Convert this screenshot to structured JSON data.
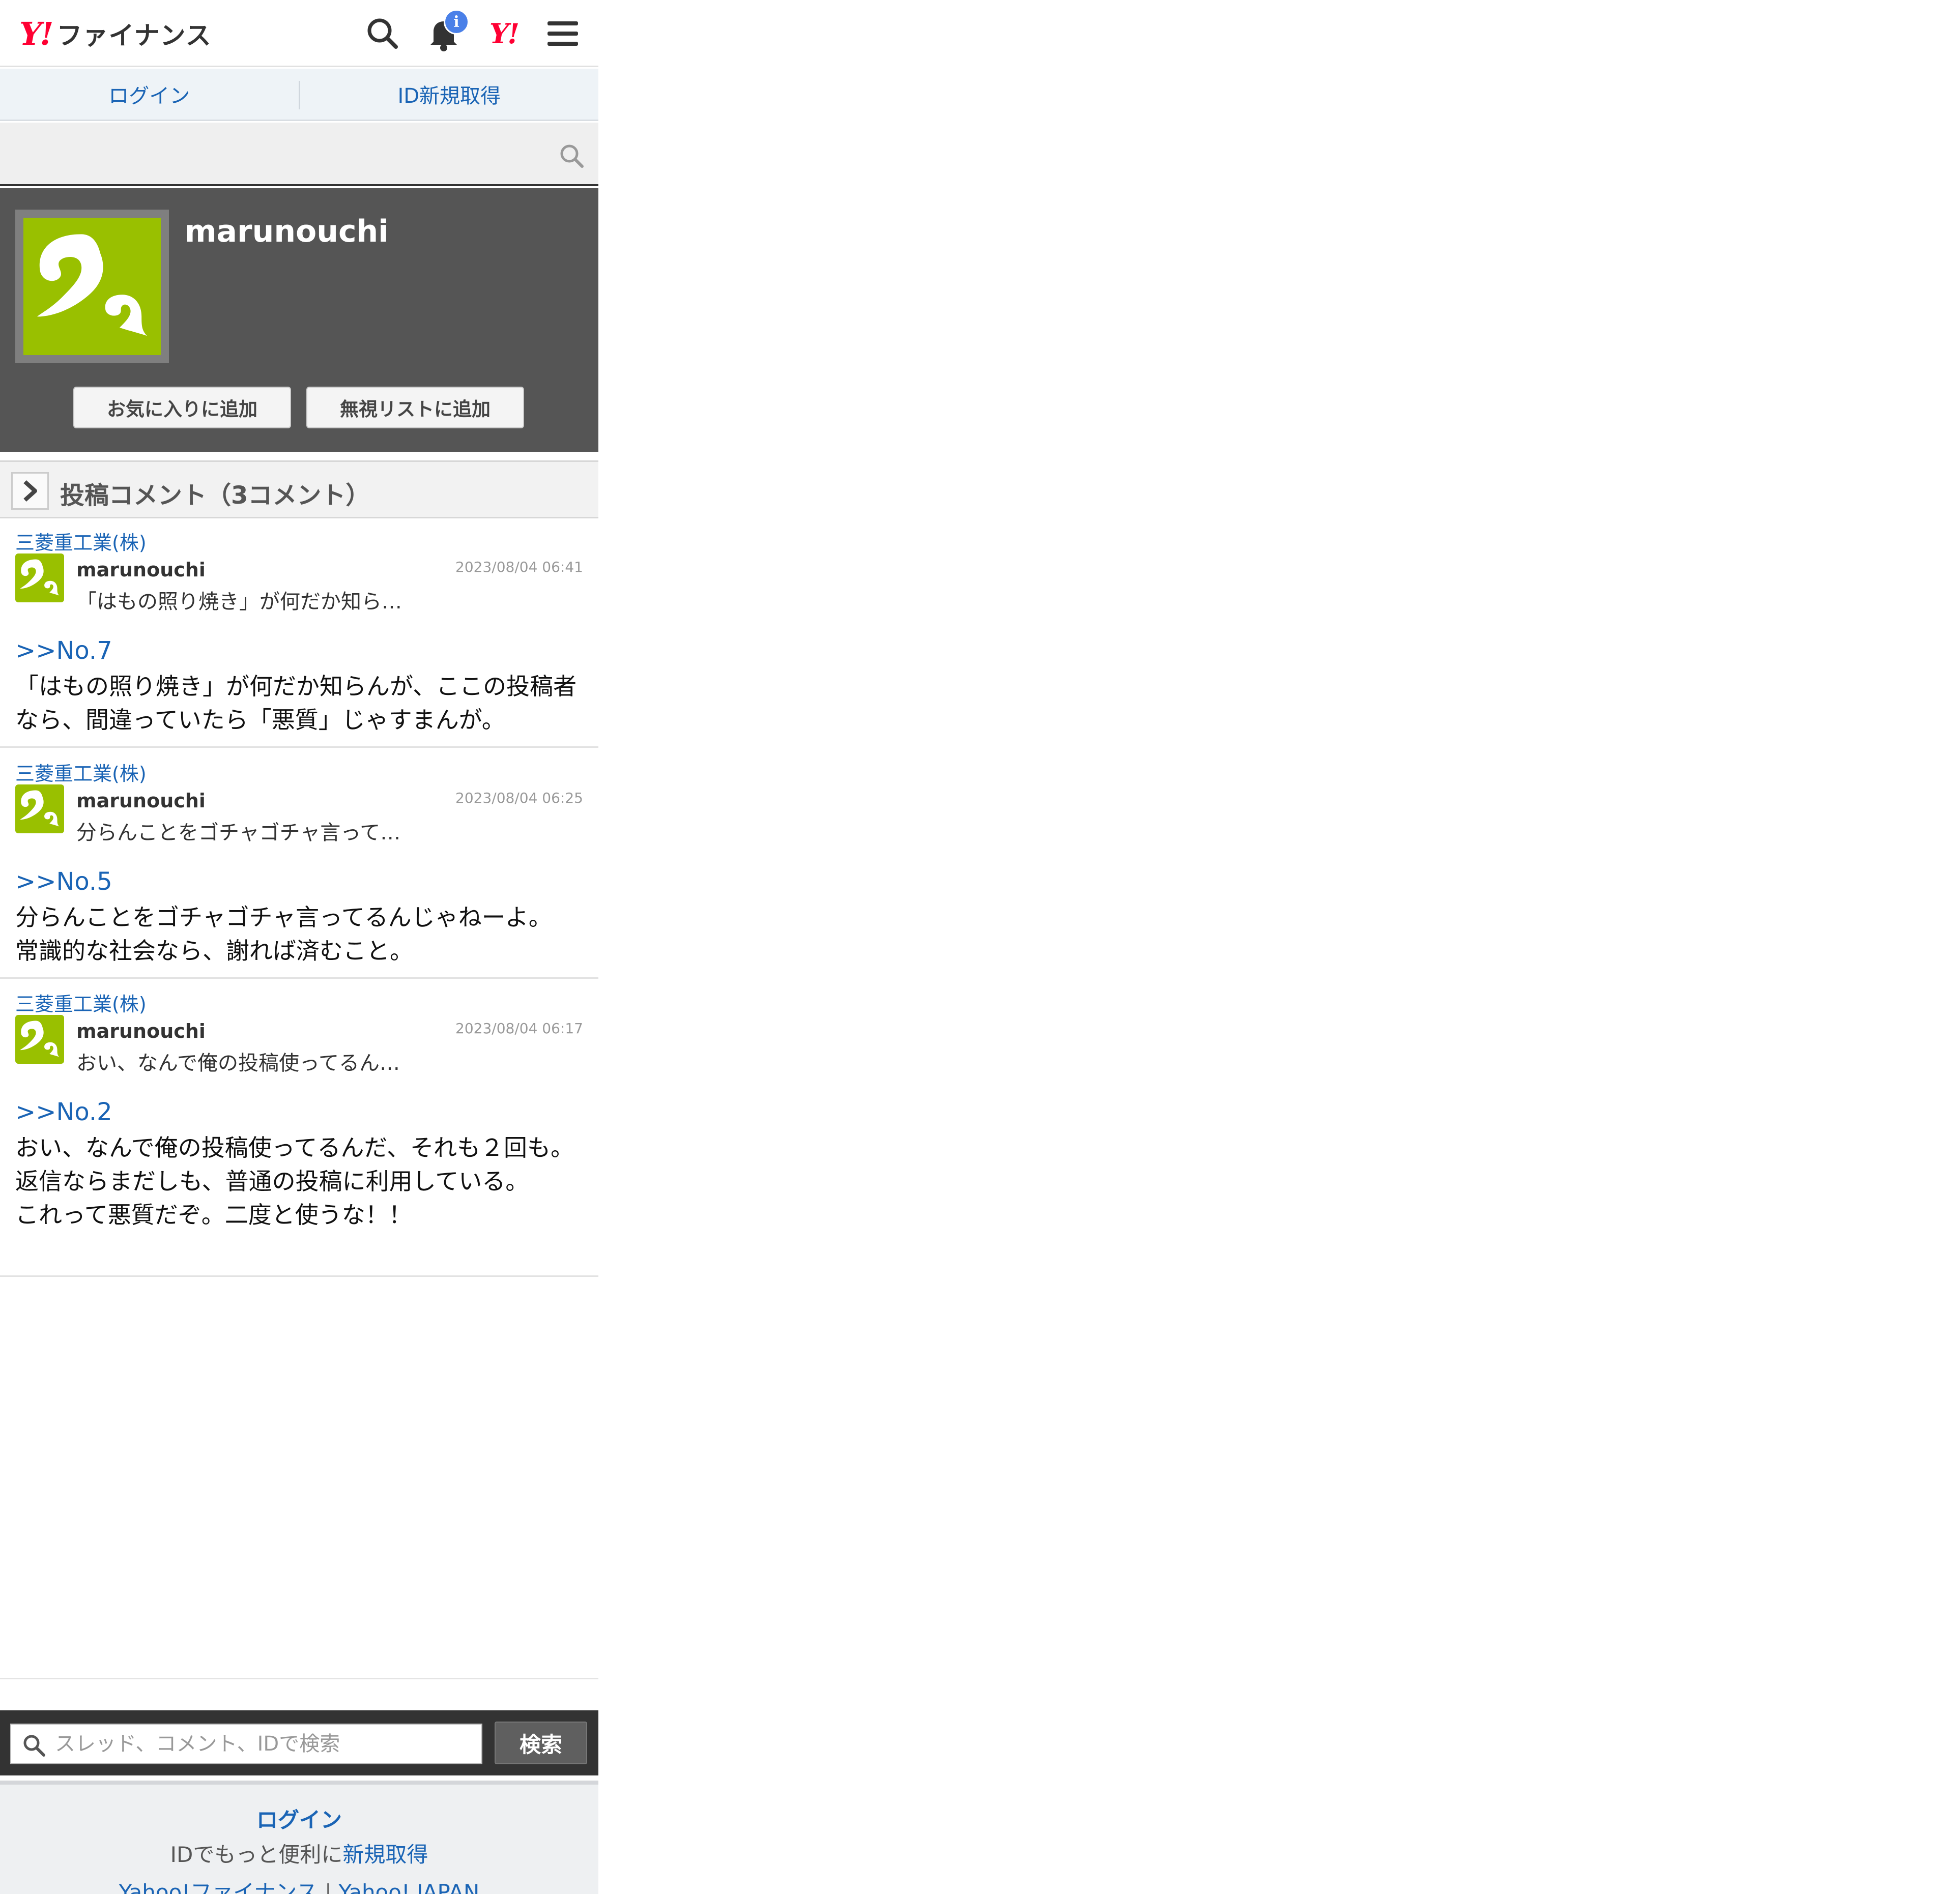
{
  "header": {
    "logo_mark": "Y!",
    "logo_text": "ファイナンス",
    "bell_badge": "i",
    "yj_mark": "Y!",
    "icons": [
      "search-icon",
      "bell-icon",
      "yahoo-japan-icon",
      "hamburger-menu-icon"
    ]
  },
  "loginbar": {
    "login": "ログイン",
    "register": "ID新規取得"
  },
  "profile": {
    "name": "marunouchi",
    "favorite_button": "お気に入りに追加",
    "ignore_button": "無視リストに追加",
    "avatar_color": "#99c000"
  },
  "section": {
    "title": "投稿コメント（3コメント）"
  },
  "comments": [
    {
      "company": "三菱重工業(株)",
      "user": "marunouchi",
      "date": "2023/08/04 06:41",
      "snippet": "「はもの照り焼き」が何だか知ら…",
      "reply_to": ">>No.7",
      "body": "「はもの照り焼き」が何だか知らんが、ここの投稿者なら、間違っていたら「悪質」じゃすまんが。"
    },
    {
      "company": "三菱重工業(株)",
      "user": "marunouchi",
      "date": "2023/08/04 06:25",
      "snippet": "分らんことをゴチャゴチャ言って…",
      "reply_to": ">>No.5",
      "body": "分らんことをゴチャゴチャ言ってるんじゃねーよ。\n常識的な社会なら、謝れば済むこと。"
    },
    {
      "company": "三菱重工業(株)",
      "user": "marunouchi",
      "date": "2023/08/04 06:17",
      "snippet": "おい、なんで俺の投稿使ってるん…",
      "reply_to": ">>No.2",
      "body": "おい、なんで俺の投稿使ってるんだ、それも２回も。\n返信ならまだしも、普通の投稿に利用している。\nこれって悪質だぞ。二度と使うな！！"
    }
  ],
  "bottom_search": {
    "placeholder": "スレッド、コメント、IDで検索",
    "button": "検索"
  },
  "footer": {
    "login": "ログイン",
    "line2_prefix": "IDでもっと便利に",
    "line2_link": "新規取得",
    "link_finance": "Yahoo!ファイナンス",
    "separator": "|",
    "link_japan": "Yahoo! JAPAN"
  },
  "colors": {
    "link": "#1a64b5",
    "brand_red": "#ff0033",
    "profile_bg": "#555555",
    "avatar_green": "#99c000"
  }
}
